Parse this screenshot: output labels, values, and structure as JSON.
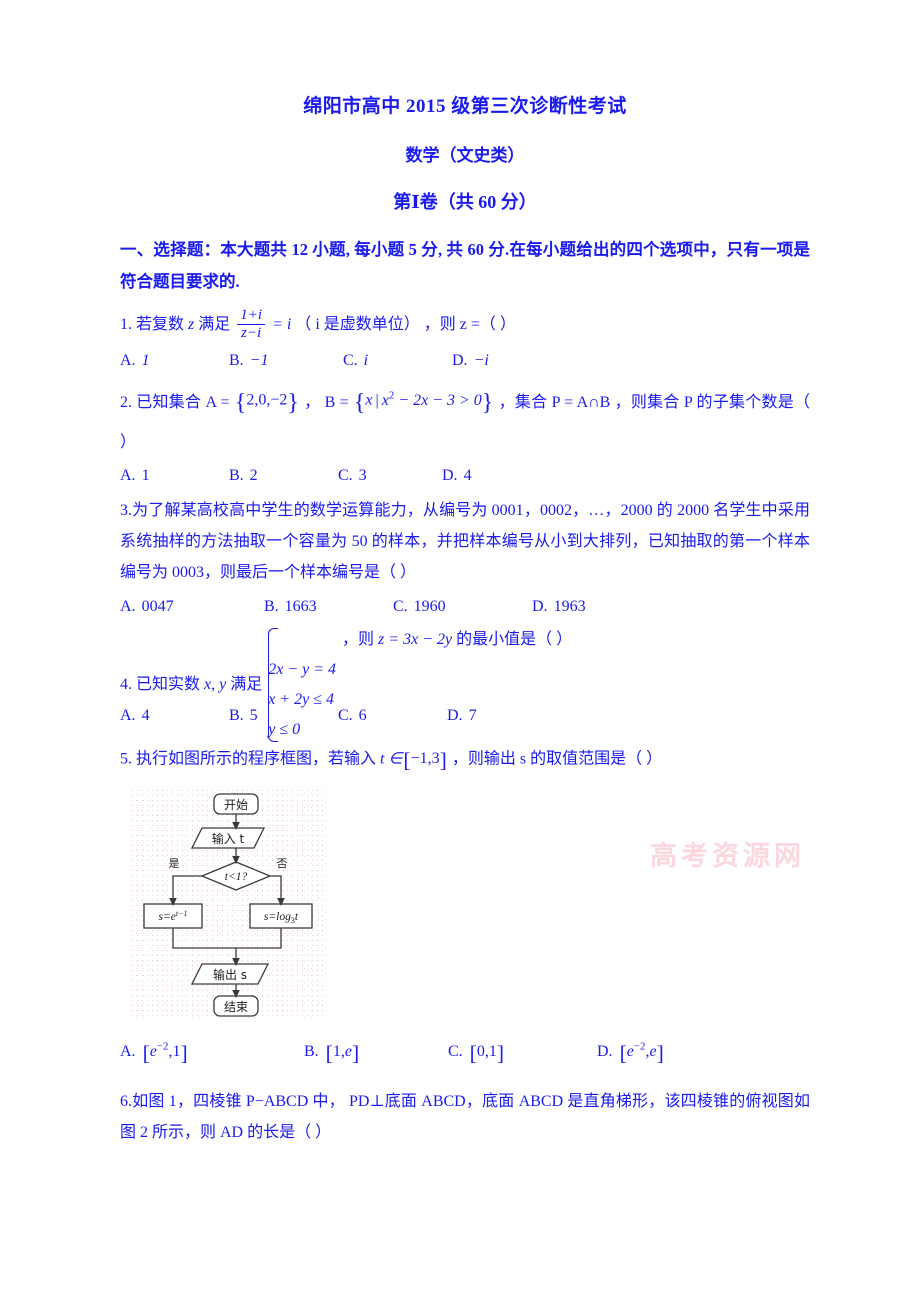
{
  "document": {
    "title": "绵阳市高中 2015 级第三次诊断性考试",
    "subtitle": "数学（文史类）",
    "section": "第Ⅰ卷（共 60 分）",
    "watermark": "高考资源网"
  },
  "instruction": {
    "text": "一、选择题：本大题共 12 小题, 每小题 5 分, 共 60 分.在每小题给出的四个选项中，只有一项是符合题目要求的."
  },
  "questions": [
    {
      "number": "1.",
      "stem_pre": "若复数",
      "var_z": "z",
      "stem_mid": "满足",
      "frac_num": "1+i",
      "frac_den": "z−i",
      "eq": "= i",
      "paren_note": "（ i 是虚数单位）",
      "stem_post": "，则 z =（    ）",
      "options": [
        {
          "label": "A.",
          "value": "1"
        },
        {
          "label": "B.",
          "value": "−1"
        },
        {
          "label": "C.",
          "value": "i"
        },
        {
          "label": "D.",
          "value": "−i"
        }
      ]
    },
    {
      "number": "2.",
      "stem_a": "已知集合 A =",
      "set_a": "{2,0,−2}",
      "stem_b": "，  B =",
      "set_b_var": "x",
      "set_b_cond": "x² − 2x − 3 > 0",
      "stem_c": "，集合 P = A∩B ，则集合 P 的子集个数是（    ）",
      "options": [
        {
          "label": "A.",
          "value": "1"
        },
        {
          "label": "B.",
          "value": "2"
        },
        {
          "label": "C.",
          "value": "3"
        },
        {
          "label": "D.",
          "value": "4"
        }
      ]
    },
    {
      "number": "3.",
      "stem": "为了解某高校高中学生的数学运算能力，从编号为 0001，0002，…，2000 的 2000 名学生中采用系统抽样的方法抽取一个容量为 50 的样本，并把样本编号从小到大排列，已知抽取的第一个样本编号为 0003，则最后一个样本编号是（    ）",
      "options": [
        {
          "label": "A.",
          "value": "0047"
        },
        {
          "label": "B.",
          "value": "1663"
        },
        {
          "label": "C.",
          "value": "1960"
        },
        {
          "label": "D.",
          "value": "1963"
        }
      ]
    },
    {
      "number": "4.",
      "stem_pre": "已知实数",
      "vars": "x, y",
      "stem_mid": "满足",
      "system": [
        "2x − y = 4",
        "x + 2y ≤ 4",
        "y ≤ 0"
      ],
      "comma": "，则",
      "objective": "z = 3x − 2y",
      "stem_post": "的最小值是（    ）",
      "options": [
        {
          "label": "A.",
          "value": "4"
        },
        {
          "label": "B.",
          "value": "5"
        },
        {
          "label": "C.",
          "value": "6"
        },
        {
          "label": "D.",
          "value": "7"
        }
      ]
    },
    {
      "number": "5.",
      "stem_pre": "执行如图所示的程序框图，若输入",
      "input_var": "t ∈",
      "interval": "[−1,3]",
      "stem_post": "，则输出 s 的取值范围是（    ）",
      "options": [
        {
          "label": "A.",
          "value": "[e⁻²,1]"
        },
        {
          "label": "B.",
          "value": "[1,e]"
        },
        {
          "label": "C.",
          "value": "[0,1]"
        },
        {
          "label": "D.",
          "value": "[e⁻²,e]"
        }
      ]
    },
    {
      "number": "6.",
      "stem": "如图 1，四棱锥 P−ABCD 中， PD⊥底面 ABCD，底面 ABCD 是直角梯形，该四棱锥的俯视图如图 2 所示，则 AD 的长是（    ）"
    }
  ],
  "flowchart": {
    "nodes": {
      "start": "开始",
      "input": "输入 t",
      "decision": "t<1?",
      "yes": "是",
      "no": "否",
      "branch_yes": "s=e",
      "branch_yes_exp": "t−1",
      "branch_no": "s=log",
      "branch_no_sub": "3",
      "branch_no_var": "t",
      "output": "输出 s",
      "end": "结束"
    }
  },
  "colors": {
    "text": "#1a1aee",
    "figure_line": "#3a3a3a",
    "watermark": "#fbd5de"
  }
}
